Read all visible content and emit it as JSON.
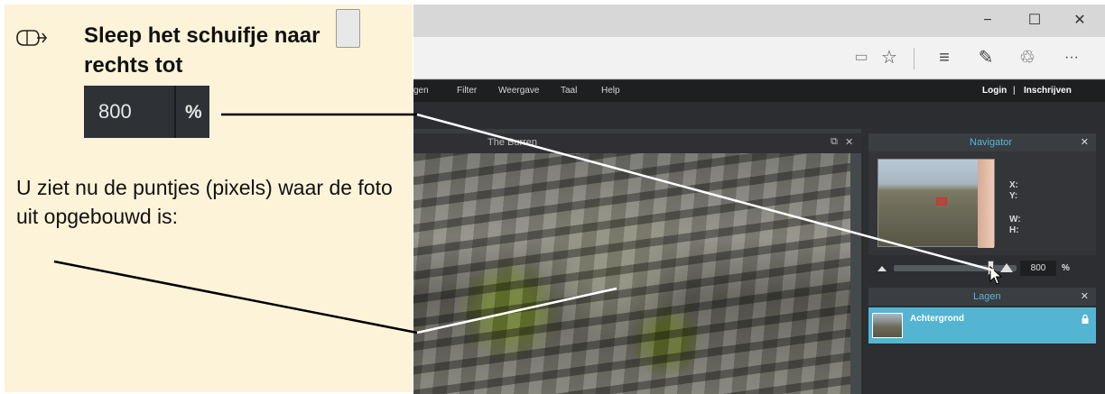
{
  "instruction": {
    "step1_text": "Sleep het schuifje naar rechts tot",
    "zoom_example_value": "800",
    "zoom_example_unit": "%",
    "step2_text": "U ziet nu de puntjes (pixels) waar de foto uit opgebouwd is:",
    "icons": [
      "mouse-pointer-icon",
      "slider-handle-icon"
    ]
  },
  "browser": {
    "window_controls": [
      "−",
      "☐",
      "✕"
    ],
    "toolbar_icons": [
      "reading-view-icon",
      "favorite-star-icon",
      "hub-icon",
      "web-note-icon",
      "share-icon",
      "more-icon"
    ],
    "toolbar_glyphs": [
      "▭",
      "☆",
      "≡",
      "✎",
      "♲",
      "···"
    ]
  },
  "app": {
    "menu": {
      "items": [
        "gen",
        "Filter",
        "Weergave",
        "Taal",
        "Help"
      ],
      "login": "Login",
      "separator": "|",
      "register": "Inschrijven"
    },
    "document": {
      "title": "The Burren",
      "controls": [
        "⧉",
        "✕"
      ]
    },
    "navigator": {
      "title": "Navigator",
      "close": "✕",
      "x_label": "X:",
      "y_label": "Y:",
      "w_label": "W:",
      "h_label": "H:",
      "zoom_value": "800",
      "zoom_unit": "%",
      "zoom_slider_fraction": 0.95
    },
    "layers": {
      "title": "Lagen",
      "close": "✕",
      "items": [
        {
          "name": "Achtergrond",
          "locked": true
        }
      ]
    }
  },
  "colors": {
    "panel_bg": "#fdf3d8",
    "accent_blue": "#54b5d2",
    "navigator_title": "#57b9d8",
    "dark_ui": "#2c2e31"
  }
}
